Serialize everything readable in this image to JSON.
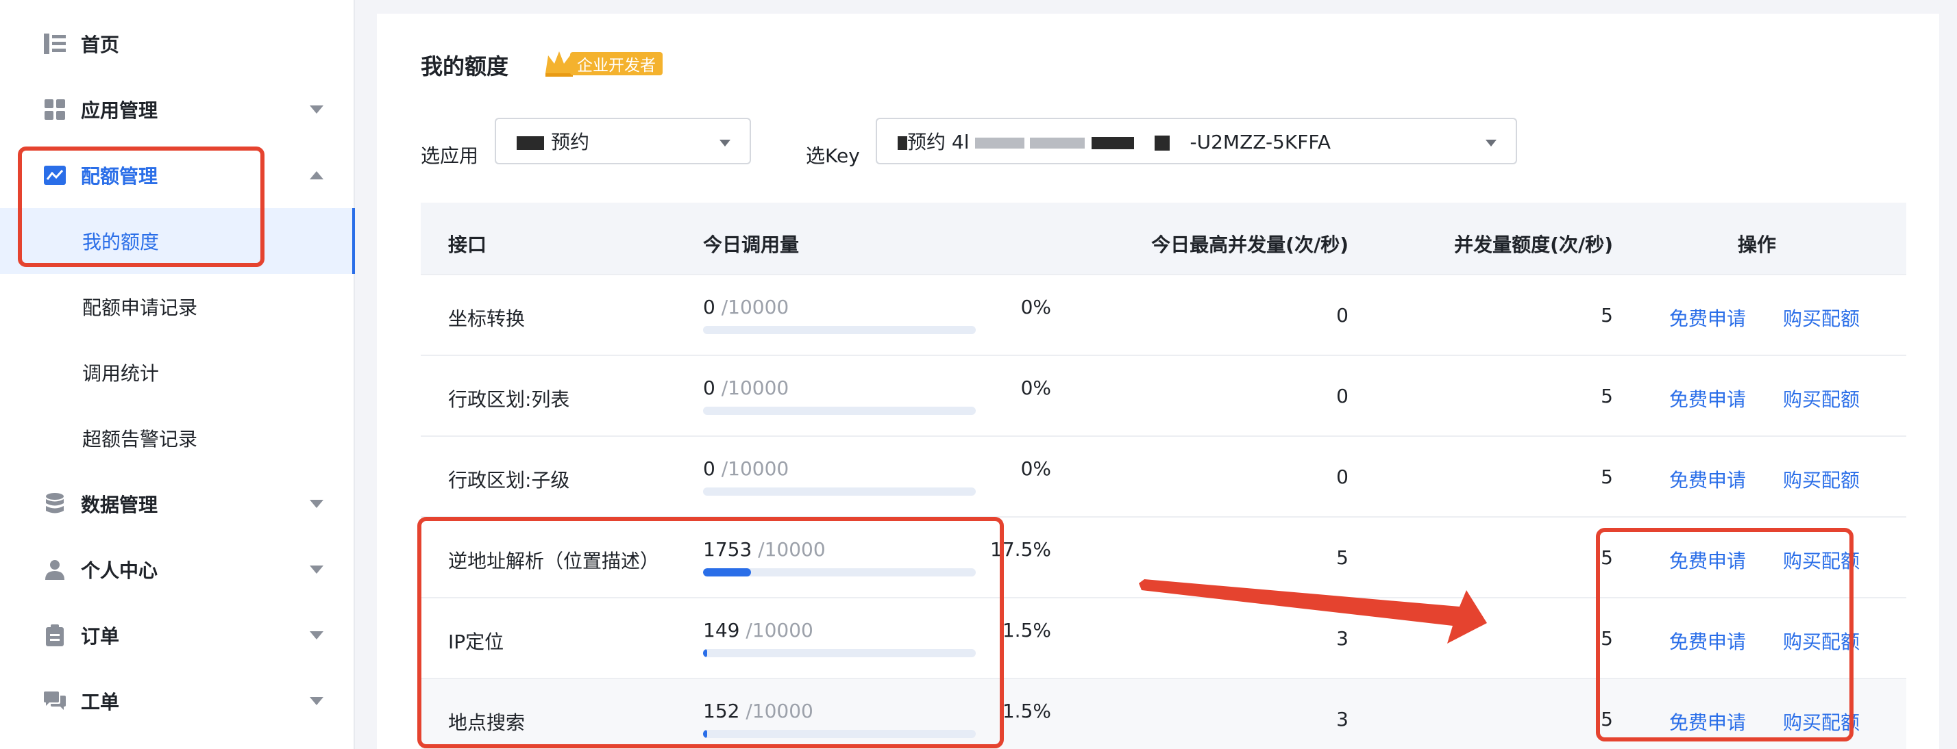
{
  "sidebar": {
    "items": [
      {
        "label": "首页",
        "icon": "list-icon"
      },
      {
        "label": "应用管理",
        "icon": "grid-icon"
      },
      {
        "label": "配额管理",
        "icon": "chart-icon"
      },
      {
        "label": "数据管理",
        "icon": "database-icon"
      },
      {
        "label": "个人中心",
        "icon": "user-icon"
      },
      {
        "label": "订单",
        "icon": "clipboard-icon"
      },
      {
        "label": "工单",
        "icon": "chat-icon"
      }
    ],
    "quota_subitems": [
      {
        "label": "我的额度"
      },
      {
        "label": "配额申请记录"
      },
      {
        "label": "调用统计"
      },
      {
        "label": "超额告警记录"
      }
    ]
  },
  "main": {
    "title": "我的额度",
    "badge": "企业开发者",
    "app_select_label": "选应用",
    "app_select_value": "预约",
    "key_select_label": "选Key",
    "key_select_prefix": "预约 4l",
    "key_select_suffix": "-U2MZZ-5KFFA",
    "colors": {
      "accent": "#2a6ee8",
      "highlight": "#e5432f",
      "badge": "#f4b22e"
    }
  },
  "table": {
    "headers": {
      "api": "接口",
      "today_calls": "今日调用量",
      "today_peak": "今日最高并发量(次/秒)",
      "concurrency_quota": "并发量额度(次/秒)",
      "ops": "操作"
    },
    "rows": [
      {
        "name": "坐标转换",
        "used": "0",
        "limit": "/10000",
        "pct_text": "0%",
        "ratio": 0.0,
        "peak": "0",
        "quota": "5",
        "op1": "免费申请",
        "op2": "购买配额"
      },
      {
        "name": "行政区划:列表",
        "used": "0",
        "limit": "/10000",
        "pct_text": "0%",
        "ratio": 0.0,
        "peak": "0",
        "quota": "5",
        "op1": "免费申请",
        "op2": "购买配额"
      },
      {
        "name": "行政区划:子级",
        "used": "0",
        "limit": "/10000",
        "pct_text": "0%",
        "ratio": 0.0,
        "peak": "0",
        "quota": "5",
        "op1": "免费申请",
        "op2": "购买配额"
      },
      {
        "name": "逆地址解析（位置描述）",
        "used": "1753",
        "limit": "/10000",
        "pct_text": "17.5%",
        "ratio": 0.175,
        "peak": "5",
        "quota": "5",
        "op1": "免费申请",
        "op2": "购买配额"
      },
      {
        "name": "IP定位",
        "used": "149",
        "limit": "/10000",
        "pct_text": "1.5%",
        "ratio": 0.015,
        "peak": "3",
        "quota": "5",
        "op1": "免费申请",
        "op2": "购买配额"
      },
      {
        "name": "地点搜索",
        "used": "152",
        "limit": "/10000",
        "pct_text": "1.5%",
        "ratio": 0.015,
        "peak": "3",
        "quota": "5",
        "op1": "免费申请",
        "op2": "购买配额"
      }
    ]
  }
}
